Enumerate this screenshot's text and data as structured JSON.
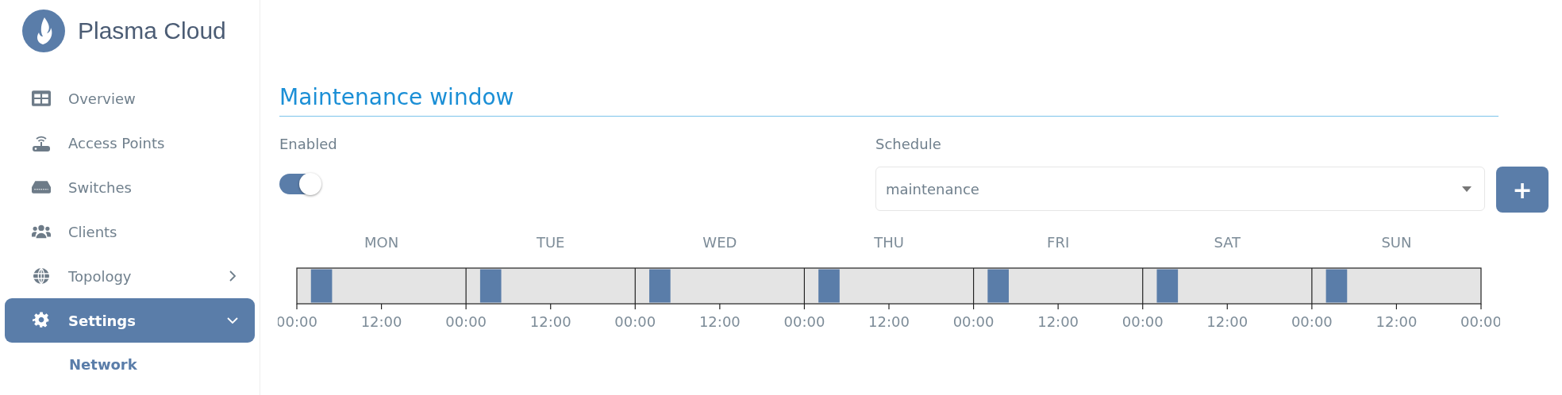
{
  "brand": {
    "name": "Plasma Cloud"
  },
  "sidebar": {
    "items": [
      {
        "label": "Overview",
        "kind": "grid",
        "selected": false
      },
      {
        "label": "Access Points",
        "kind": "router",
        "selected": false
      },
      {
        "label": "Switches",
        "kind": "switch",
        "selected": false
      },
      {
        "label": "Clients",
        "kind": "users",
        "selected": false
      },
      {
        "label": "Topology",
        "kind": "globe",
        "selected": false,
        "expanded": false
      },
      {
        "label": "Settings",
        "kind": "gear",
        "selected": true,
        "expanded": true,
        "children": [
          {
            "label": "Network",
            "selected": true
          }
        ]
      }
    ]
  },
  "section": {
    "title": "Maintenance window"
  },
  "enabled": {
    "label": "Enabled",
    "on": true
  },
  "schedule": {
    "label": "Schedule",
    "value": "maintenance",
    "add_button": "+"
  },
  "timeline": {
    "days": [
      {
        "label": "MON"
      },
      {
        "label": "TUE"
      },
      {
        "label": "WED"
      },
      {
        "label": "THU"
      },
      {
        "label": "FRI"
      },
      {
        "label": "SAT"
      },
      {
        "label": "SUN"
      }
    ],
    "ticks": [
      "00:00",
      "12:00",
      "00:00",
      "12:00",
      "00:00",
      "12:00",
      "00:00",
      "12:00",
      "00:00",
      "12:00",
      "00:00",
      "12:00",
      "00:00",
      "12:00",
      "00:00"
    ]
  }
}
